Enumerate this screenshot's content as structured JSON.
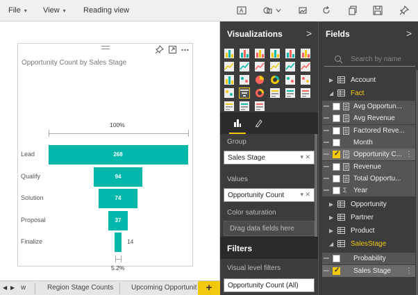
{
  "toolbar": {
    "menus": [
      {
        "label": "File"
      },
      {
        "label": "View"
      },
      {
        "label": "Reading view"
      }
    ],
    "icons": [
      "text-box-icon",
      "shapes-icon",
      "image-icon",
      "refresh-icon",
      "duplicate-page-icon",
      "save-icon",
      "pin-icon"
    ]
  },
  "visual": {
    "title": "Opportunity Count by Sales Stage",
    "icons": [
      "pin-icon",
      "focus-mode-icon",
      "more-options-icon"
    ]
  },
  "chart_data": {
    "type": "funnel",
    "title": "Opportunity Count by Sales Stage",
    "categories": [
      "Lead",
      "Qualify",
      "Solution",
      "Proposal",
      "Finalize"
    ],
    "values": [
      268,
      94,
      74,
      37,
      14
    ],
    "top_percent_label": "100%",
    "bottom_percent_label": "5.2%",
    "bar_color": "#01b8aa"
  },
  "tabs": {
    "nav_prev": "◀",
    "nav_next": "▶",
    "items": [
      {
        "label": "w"
      },
      {
        "label": "Region Stage Counts"
      },
      {
        "label": "Upcoming Opportunit"
      }
    ],
    "add_label": "+"
  },
  "visualizations": {
    "title": "Visualizations",
    "arrow": ">",
    "more": "...",
    "group_label": "Group",
    "group_value": "Sales Stage",
    "values_label": "Values",
    "values_value": "Opportunity Count",
    "color_sat_label": "Color saturation",
    "drop_hint": "Drag data fields here"
  },
  "filters": {
    "title": "Filters",
    "level_label": "Visual level filters",
    "filter_value": "Opportunity Count (All)"
  },
  "fields": {
    "title": "Fields",
    "arrow": ">",
    "search_placeholder": "Search by name",
    "tables": [
      {
        "name": "Account",
        "expanded": false
      },
      {
        "name": "Fact",
        "expanded": true
      },
      {
        "name": "Opportunity",
        "expanded": false
      },
      {
        "name": "Partner",
        "expanded": false
      },
      {
        "name": "Product",
        "expanded": false
      },
      {
        "name": "SalesStage",
        "expanded": true
      }
    ],
    "fact_items": [
      {
        "name": "Avg Opportun...",
        "checked": false,
        "kind": "measure"
      },
      {
        "name": "Avg Revenue",
        "checked": false,
        "kind": "measure"
      },
      {
        "name": "Factored Reve...",
        "checked": false,
        "kind": "measure"
      },
      {
        "name": "Month",
        "checked": false,
        "kind": "column"
      },
      {
        "name": "Opportunity C...",
        "checked": true,
        "kind": "measure"
      },
      {
        "name": "Revenue",
        "checked": false,
        "kind": "measure"
      },
      {
        "name": "Total Opportu...",
        "checked": false,
        "kind": "measure"
      },
      {
        "name": "Year",
        "checked": false,
        "kind": "sum"
      }
    ],
    "salesstage_items": [
      {
        "name": "Probability",
        "checked": false,
        "kind": "column"
      },
      {
        "name": "Sales Stage",
        "checked": true,
        "kind": "column"
      }
    ],
    "ellipsis": "⋮",
    "accent": "#f2c80f"
  }
}
